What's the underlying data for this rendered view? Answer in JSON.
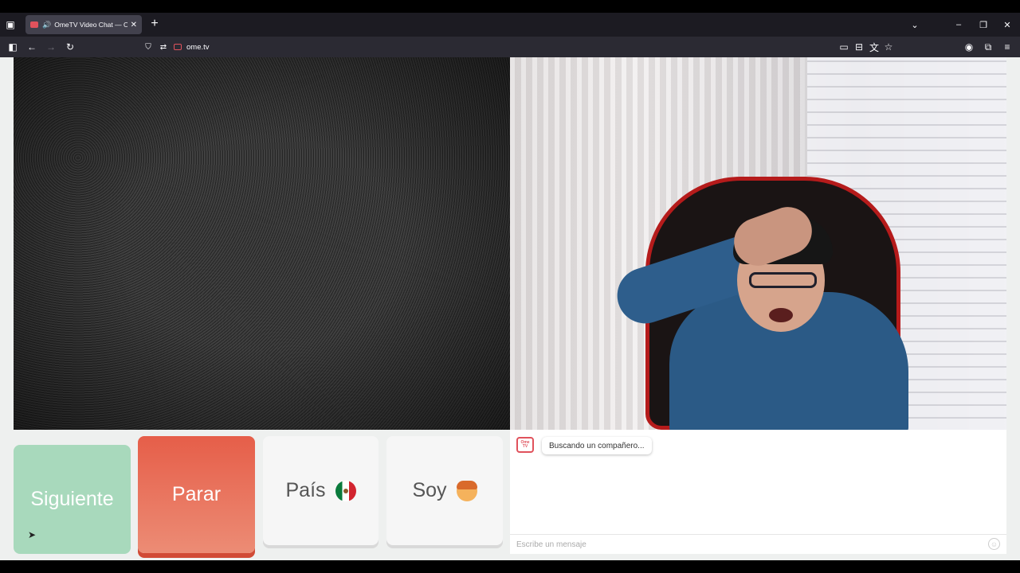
{
  "browser": {
    "tab_title": "OmeTV Video Chat — Omegle",
    "url": "ome.tv",
    "icons": [
      "tab-list-icon",
      "speaker-icon",
      "close-tab-icon",
      "new-tab-icon",
      "list-all-tabs-icon",
      "minimize-icon",
      "maximize-icon",
      "close-window-icon",
      "sidebar-icon",
      "back-icon",
      "forward-icon",
      "reload-icon",
      "shield-icon",
      "permissions-icon",
      "pip-icon",
      "save-icon",
      "translate-icon",
      "bookmark-star-icon",
      "account-icon",
      "extensions-icon",
      "menu-icon"
    ]
  },
  "page": {
    "buttons": {
      "next": "Siguiente",
      "stop": "Parar",
      "country": "País",
      "gender": "Soy"
    },
    "chat": {
      "logo_text": "Ome TV",
      "status_message": "Buscando un compañero...",
      "input_placeholder": "Escribe un mensaje"
    },
    "colors": {
      "next_button": "#a8d9bc",
      "stop_button": "#e65e49",
      "neutral_button": "#f6f6f6"
    }
  }
}
